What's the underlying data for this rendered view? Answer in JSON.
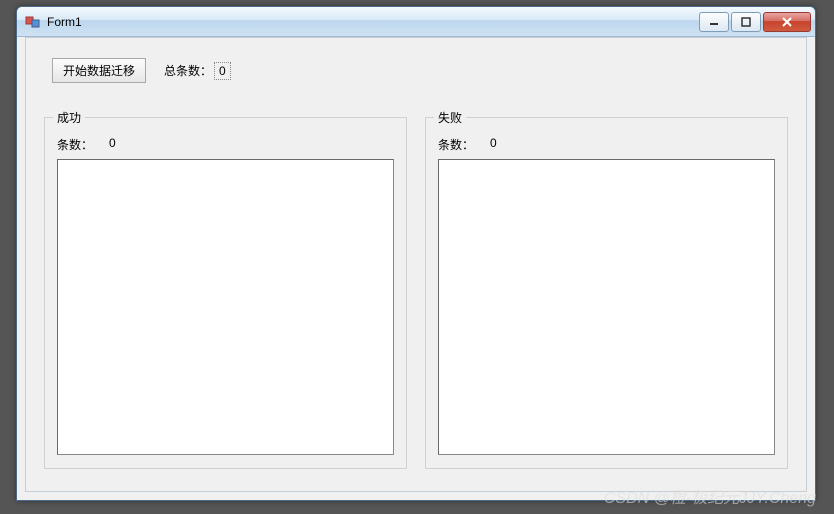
{
  "window": {
    "title": "Form1"
  },
  "toolbar": {
    "migrate_button_label": "开始数据迁移",
    "total_label": "总条数：",
    "total_value": "0"
  },
  "panels": {
    "success": {
      "title": "成功",
      "count_label": "条数：",
      "count_value": "0",
      "content": ""
    },
    "fail": {
      "title": "失败",
      "count_label": "条数：",
      "count_value": "0",
      "content": ""
    }
  },
  "watermark": "CSDN @橙-极纪元JJY.Cheng"
}
